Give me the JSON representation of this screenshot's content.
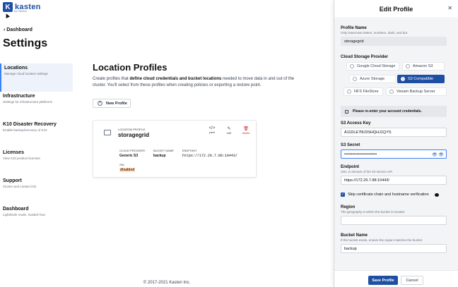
{
  "brand": {
    "name": "kasten",
    "sub": "by Veeam",
    "mark": "K"
  },
  "breadcrumb": {
    "arrow": "‹",
    "label": "Dashboard"
  },
  "page": {
    "title": "Settings"
  },
  "sidebar": {
    "items": [
      {
        "title": "Locations",
        "desc": "Manage cloud location settings",
        "active": true
      },
      {
        "title": "Infrastructure",
        "desc": "Settings for infrastructure platforms"
      },
      {
        "title": "K10 Disaster Recovery",
        "desc": "Enable backup/recovery of K10"
      },
      {
        "title": "Licenses",
        "desc": "View K10 product licenses"
      },
      {
        "title": "Support",
        "desc": "Cluster and contact info"
      },
      {
        "title": "Dashboard",
        "desc": "Light/Dark mode, Guided Tour."
      }
    ]
  },
  "main": {
    "title": "Location Profiles",
    "desc_pre": "Create profiles that ",
    "desc_bold": "define cloud credentials and bucket locations",
    "desc_post": " needed to move data in and out of the cluster. You'll select from these profiles when creating policies or exporting a restore point.",
    "new_button": "New Profile"
  },
  "card": {
    "label": "LOCATION PROFILE",
    "name": "storagegrid",
    "actions": {
      "yaml": "yaml",
      "edit": "edit",
      "delete": "delete"
    },
    "details": {
      "provider_key": "CLOUD PROVIDER",
      "provider_val": "Generic S3",
      "bucket_key": "BUCKET NAME",
      "bucket_val": "backup",
      "endpoint_key": "ENDPOINT",
      "endpoint_val": "https://172.29.7.88:10443/",
      "ssl_key": "SSL",
      "ssl_val": "disabled"
    }
  },
  "footer": "© 2017-2021 Kasten Inc.",
  "panel": {
    "title": "Edit Profile",
    "profile_name": {
      "label": "Profile Name",
      "hint": "Only lowercase letters, numbers, dash, and dot",
      "value": "storagegrid"
    },
    "provider": {
      "label": "Cloud Storage Provider",
      "options": [
        "Google Cloud Storage",
        "Amazon S3",
        "Azure Storage",
        "S3 Compatible",
        "NFS FileStore",
        "Veeam Backup Server"
      ],
      "selected": "S3 Compatible"
    },
    "notice": "Please re-enter your account credentials.",
    "access_key": {
      "label": "S3 Access Key",
      "value": "A11DLE7l8J3SHQHJ1QYS"
    },
    "secret": {
      "label": "S3 Secret",
      "value": "••••••••••••••••••••••••"
    },
    "endpoint": {
      "label": "Endpoint",
      "hint": "URL or domain of the S3 service API",
      "value": "https://172.29.7.88:10443/"
    },
    "skip_verify": {
      "label": "Skip certificate chain and hostname verification",
      "checked": true
    },
    "region": {
      "label": "Region",
      "hint": "The geography in which the bucket is located",
      "value": ""
    },
    "bucket": {
      "label": "Bucket Name",
      "hint": "If the bucket exists, ensure the region matches the bucket.",
      "value": "backup"
    },
    "save": "Save Profile",
    "cancel": "Cancel"
  }
}
